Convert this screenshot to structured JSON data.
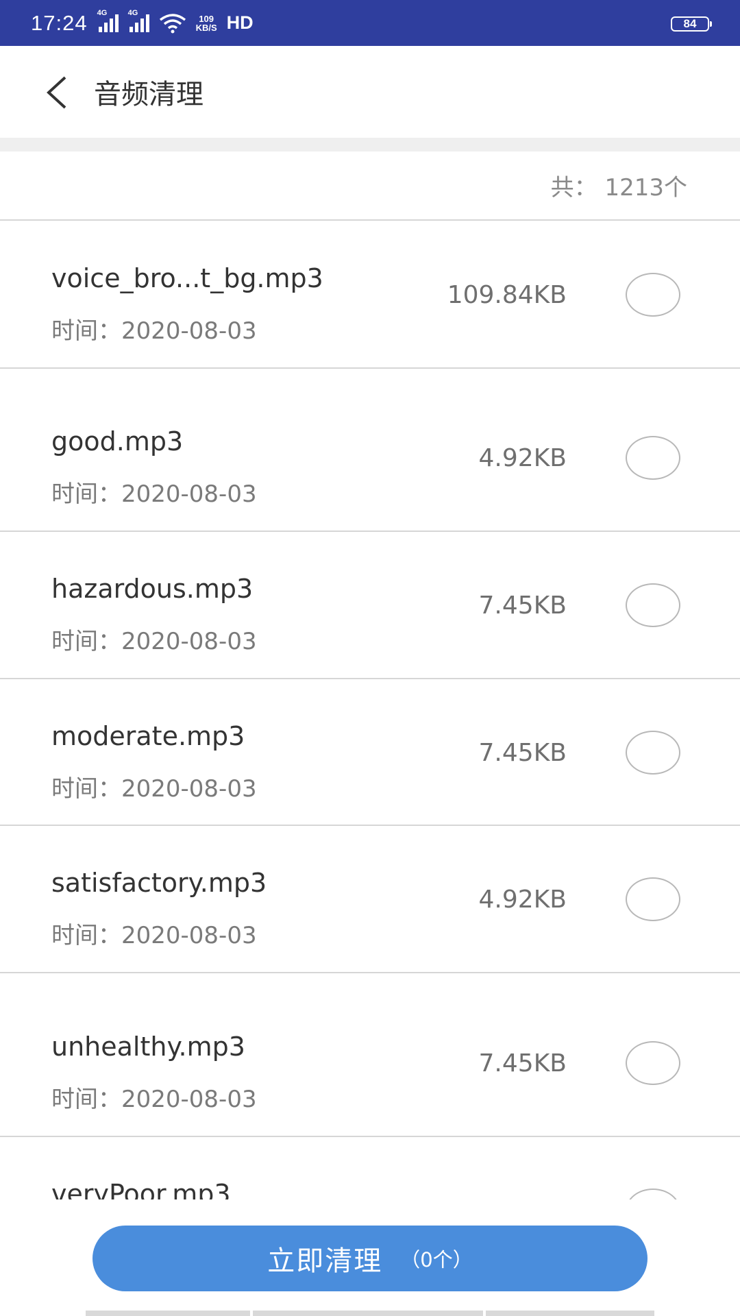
{
  "status_bar": {
    "time": "17:24",
    "signal1_label": "4G",
    "signal2_label": "4G",
    "speed_value": "109",
    "speed_unit": "KB/S",
    "hd_label": "HD",
    "battery": "84"
  },
  "header": {
    "back_icon": "chevron-left-icon",
    "title": "音频清理"
  },
  "summary": {
    "count_text": "共：  1213个"
  },
  "files": [
    {
      "name": "voice_bro...t_bg.mp3",
      "time": "时间：2020-08-03",
      "size": "109.84KB",
      "selected": false
    },
    {
      "name": "good.mp3",
      "time": "时间：2020-08-03",
      "size": "4.92KB",
      "selected": false
    },
    {
      "name": "hazardous.mp3",
      "time": "时间：2020-08-03",
      "size": "7.45KB",
      "selected": false
    },
    {
      "name": "moderate.mp3",
      "time": "时间：2020-08-03",
      "size": "7.45KB",
      "selected": false
    },
    {
      "name": "satisfactory.mp3",
      "time": "时间：2020-08-03",
      "size": "4.92KB",
      "selected": false
    },
    {
      "name": "unhealthy.mp3",
      "time": "时间：2020-08-03",
      "size": "7.45KB",
      "selected": false
    },
    {
      "name": "veryPoor.mp3",
      "selected": false
    }
  ],
  "footer": {
    "clean_label": "立即清理",
    "clean_count": "（0个）",
    "button_color": "#4a8ddc"
  },
  "colors": {
    "status_bar": "#2f3e9e",
    "divider": "#d6d6d6"
  }
}
